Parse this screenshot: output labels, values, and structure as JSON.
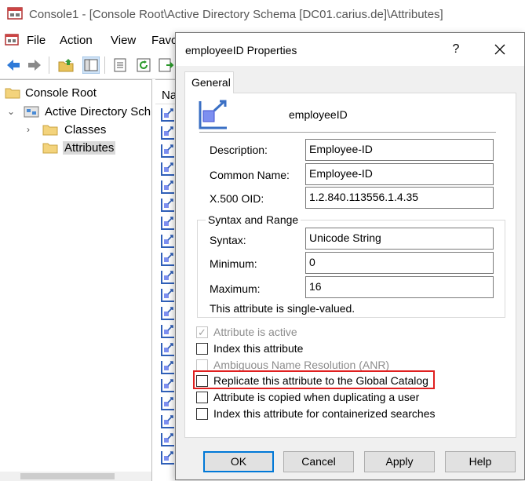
{
  "window": {
    "title": "Console1 - [Console Root\\Active Directory Schema [DC01.carius.de]\\Attributes]"
  },
  "menubar": {
    "items": [
      "File",
      "Action",
      "View",
      "Favo"
    ]
  },
  "toolbar": {
    "buttons": [
      "back-icon",
      "forward-icon",
      "up-folder-icon",
      "show-hide-tree-icon",
      "properties-icon",
      "refresh-icon",
      "export-icon"
    ]
  },
  "tree": {
    "root": "Console Root",
    "schema": "Active Directory Sch",
    "classes": "Classes",
    "attributes": "Attributes"
  },
  "list": {
    "column_header": "Na"
  },
  "dialog": {
    "title": "employeeID Properties",
    "help_label": "?",
    "tab_label": "General",
    "attribute_name": "employeeID",
    "fields": {
      "description_label": "Description:",
      "description_value": "Employee-ID",
      "common_name_label": "Common Name:",
      "common_name_value": "Employee-ID",
      "oid_label": "X.500 OID:",
      "oid_value": "1.2.840.113556.1.4.35"
    },
    "syntax_group": {
      "title": "Syntax and Range",
      "syntax_label": "Syntax:",
      "syntax_value": "Unicode String",
      "minimum_label": "Minimum:",
      "minimum_value": "0",
      "maximum_label": "Maximum:",
      "maximum_value": "16"
    },
    "single_valued_text": "This attribute is single-valued.",
    "checkboxes": [
      {
        "label": "Attribute is active",
        "checked": true,
        "disabled": true
      },
      {
        "label": "Index this attribute",
        "checked": false,
        "disabled": false
      },
      {
        "label": "Ambiguous Name Resolution (ANR)",
        "checked": false,
        "disabled": true
      },
      {
        "label": "Replicate this attribute to the Global Catalog",
        "checked": false,
        "disabled": false
      },
      {
        "label": "Attribute is copied when duplicating a user",
        "checked": false,
        "disabled": false
      },
      {
        "label": "Index this attribute for containerized searches",
        "checked": false,
        "disabled": false
      }
    ],
    "buttons": {
      "ok": "OK",
      "cancel": "Cancel",
      "apply": "Apply",
      "help": "Help"
    }
  },
  "colors": {
    "highlight": "#e02020",
    "focus": "#0078d7"
  }
}
